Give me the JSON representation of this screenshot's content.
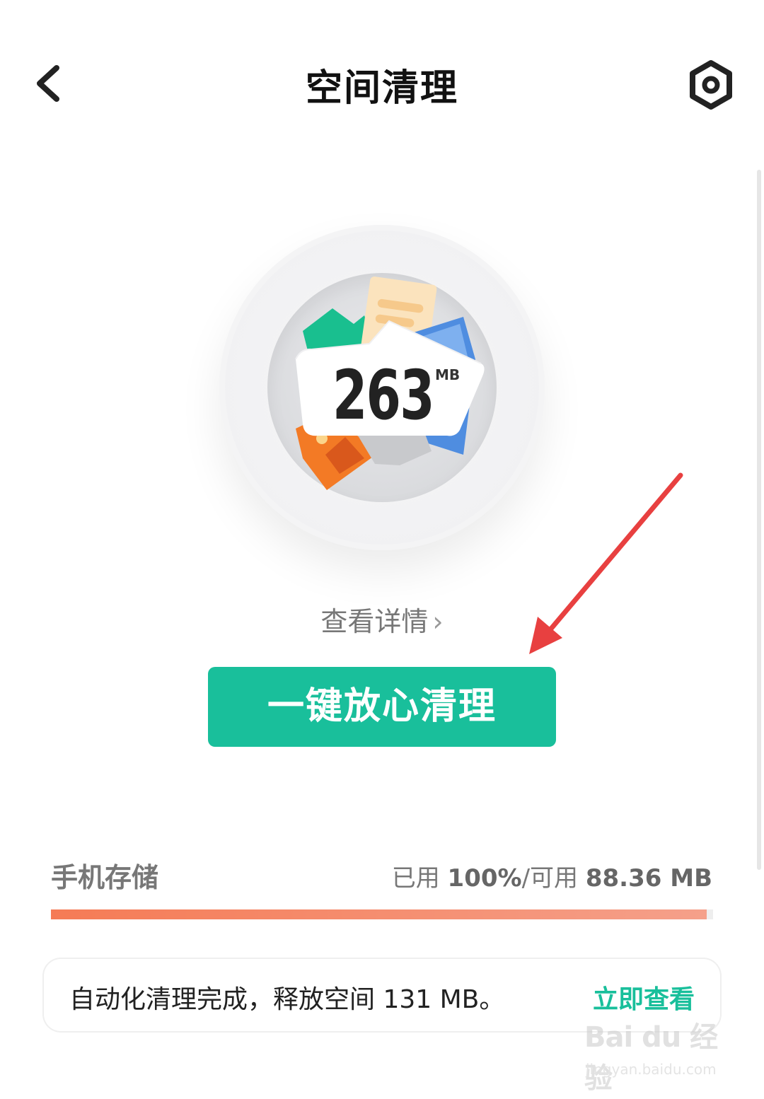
{
  "header": {
    "title": "空间清理",
    "back_icon": "chevron-left-icon",
    "settings_icon": "gear-icon"
  },
  "junk": {
    "size_value": "263",
    "size_unit": "MB"
  },
  "details_link": {
    "label": "查看详情",
    "chevron": "›"
  },
  "clean_button": {
    "label": "一键放心清理",
    "color": "#19bf9b"
  },
  "storage": {
    "label": "手机存储",
    "used_prefix": "已用 ",
    "used_percent": "100%",
    "separator": "/可用 ",
    "available": "88.36 MB",
    "fill_fraction": 0.99,
    "bar_color_start": "#f57b55",
    "bar_color_end": "#f5a08a"
  },
  "notice": {
    "text": "自动化清理完成，释放空间 131 MB。",
    "action_label": "立即查看"
  },
  "annotation": {
    "arrow_color": "#e84040"
  },
  "watermark": {
    "brand": "Bai du 经验",
    "url": "jingyan.baidu.com"
  }
}
